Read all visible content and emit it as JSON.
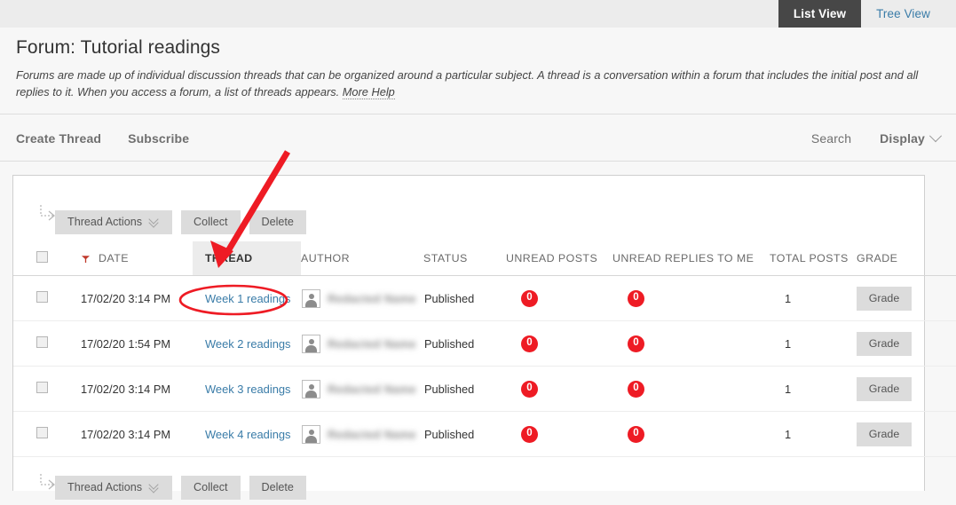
{
  "view_toggle": {
    "active": "List View",
    "inactive": "Tree View"
  },
  "header": {
    "title": "Forum: Tutorial readings",
    "description": "Forums are made up of individual discussion threads that can be organized around a particular subject. A thread is a conversation within a forum that includes the initial post and all replies to it. When you access a forum, a list of threads appears.",
    "more_help": "More Help"
  },
  "action_bar": {
    "create_thread": "Create Thread",
    "subscribe": "Subscribe",
    "search": "Search",
    "display": "Display"
  },
  "toolbar": {
    "thread_actions": "Thread Actions",
    "collect": "Collect",
    "delete": "Delete"
  },
  "table": {
    "columns": [
      "DATE",
      "THREAD",
      "AUTHOR",
      "STATUS",
      "UNREAD POSTS",
      "UNREAD REPLIES TO ME",
      "TOTAL POSTS",
      "GRADE"
    ],
    "sort_column": "DATE",
    "sort_direction": "descending",
    "highlighted_column": "THREAD",
    "grade_button_label": "Grade",
    "rows": [
      {
        "date": "17/02/20 3:14 PM",
        "thread": "Week 1 readings",
        "author": "",
        "status": "Published",
        "unread_posts": "0",
        "unread_replies_to_me": "0",
        "total_posts": "1",
        "grade": "Grade"
      },
      {
        "date": "17/02/20 1:54 PM",
        "thread": "Week 2 readings",
        "author": "",
        "status": "Published",
        "unread_posts": "0",
        "unread_replies_to_me": "0",
        "total_posts": "1",
        "grade": "Grade"
      },
      {
        "date": "17/02/20 3:14 PM",
        "thread": "Week 3 readings",
        "author": "",
        "status": "Published",
        "unread_posts": "0",
        "unread_replies_to_me": "0",
        "total_posts": "1",
        "grade": "Grade"
      },
      {
        "date": "17/02/20 3:14 PM",
        "thread": "Week 4 readings",
        "author": "",
        "status": "Published",
        "unread_posts": "0",
        "unread_replies_to_me": "0",
        "total_posts": "1",
        "grade": "Grade"
      }
    ]
  },
  "annotations": {
    "arrow_color": "#ee1b24",
    "ellipse_color": "#ee1b24",
    "ellipse_target": "Week 1 readings",
    "arrow_target": "THREAD"
  },
  "colors": {
    "accent_link": "#3a7ca8",
    "badge_red": "#ee1b24",
    "active_tab_bg": "#474747",
    "button_grey": "#dcdcdc"
  }
}
